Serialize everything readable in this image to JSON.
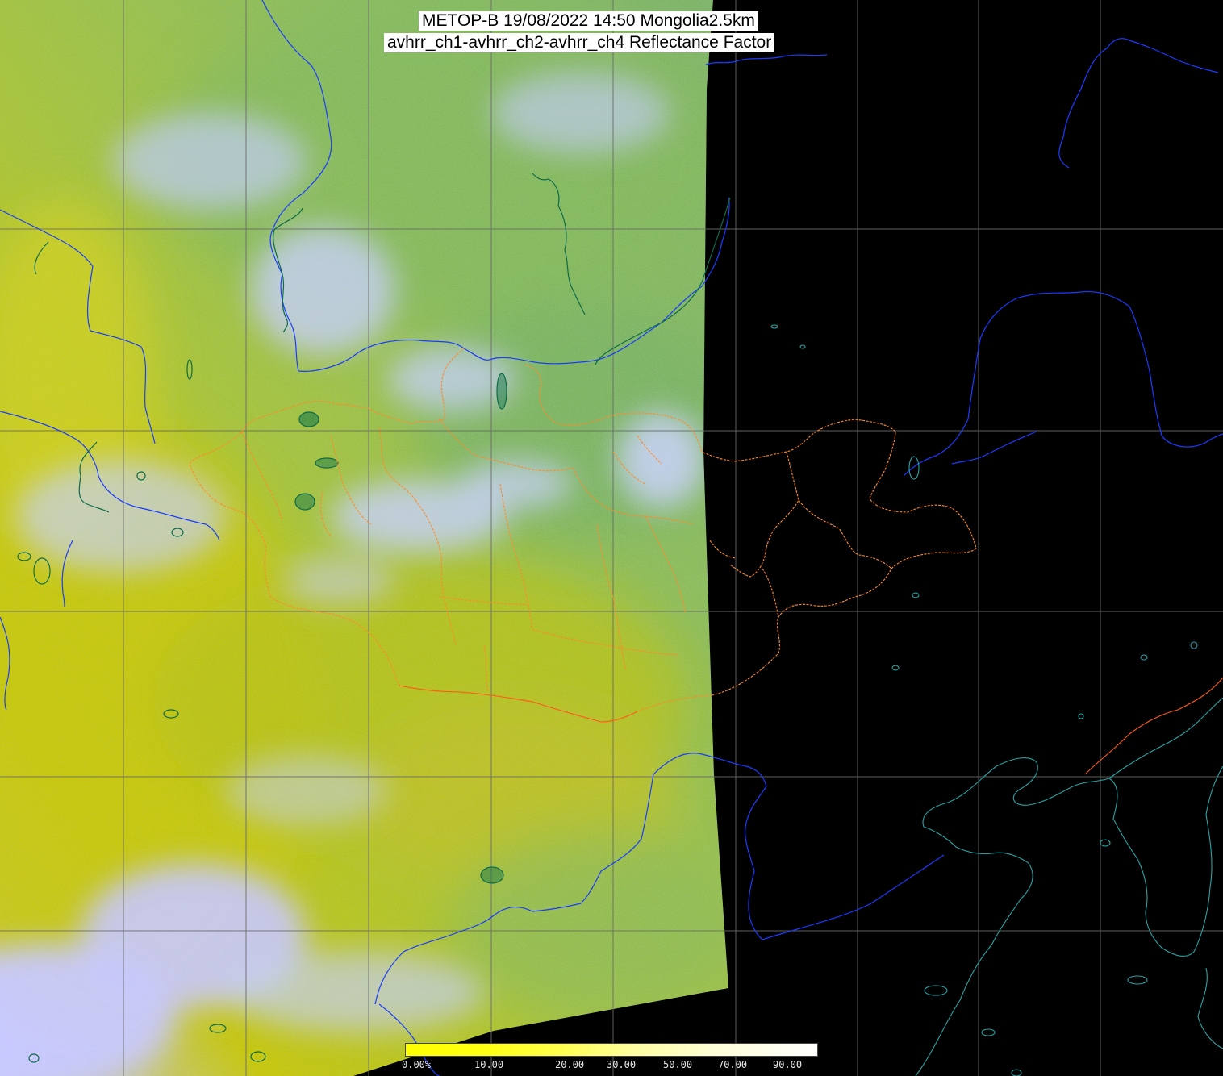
{
  "header": {
    "title_line_1": "METOP-B 19/08/2022 14:50 Mongolia2.5km",
    "title_line_2": "avhrr_ch1-avhrr_ch2-avhrr_ch4 Reflectance Factor"
  },
  "colorbar": {
    "labels": [
      "0.00%",
      "10.00",
      "20.00",
      "30.00",
      "50.00",
      "70.00",
      "90.00"
    ],
    "gradient_colors": [
      "#ffff00",
      "#ffff14",
      "#ffff50",
      "#ffffa0",
      "#ffffd8",
      "#ffffff"
    ]
  },
  "map_layers": {
    "imagery_palette": [
      "#c6c60c",
      "#a9c43a",
      "#8ebd5c",
      "#7fb46a",
      "#b7c7e6",
      "#c8c8ff"
    ],
    "background_color": "#000000",
    "graticule_color": "#6a6a6a",
    "country_border_color": "#1a3cff",
    "province_border_color": "#ff8a2a",
    "coastline_color": "#2aa3a3",
    "lake_color": "#0e6a4a"
  }
}
